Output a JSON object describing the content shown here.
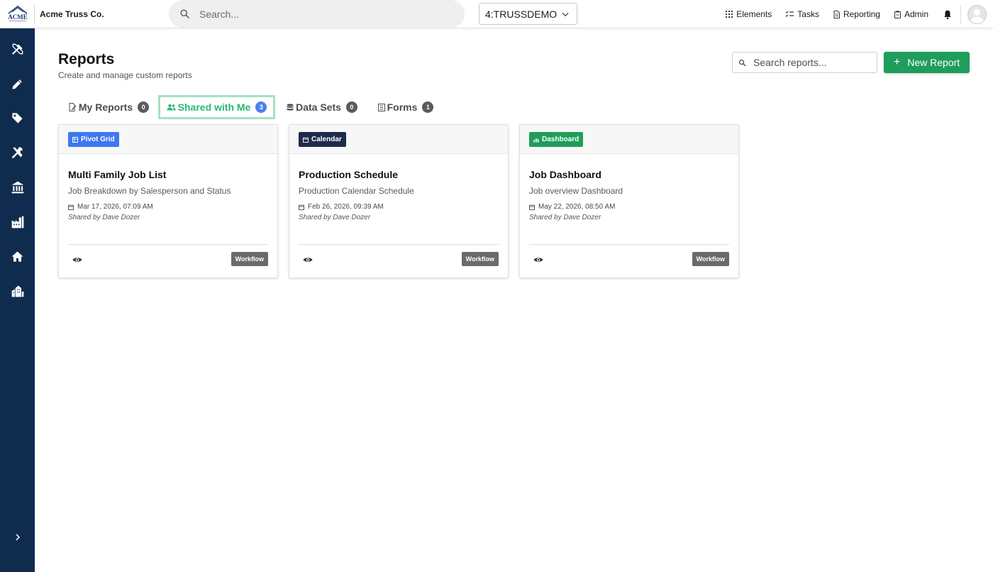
{
  "header": {
    "logo_text": "ACME",
    "company_name": "Acme Truss Co.",
    "search_placeholder": "Search...",
    "company_select": "4:TRUSSDEMO",
    "nav": {
      "elements": "Elements",
      "tasks": "Tasks",
      "reporting": "Reporting",
      "admin": "Admin"
    }
  },
  "sidebar": {
    "items": [
      {
        "icon": "design-tools-icon"
      },
      {
        "icon": "pencil-icon"
      },
      {
        "icon": "tag-icon"
      },
      {
        "icon": "tools-icon"
      },
      {
        "icon": "bank-icon"
      },
      {
        "icon": "factory-icon"
      },
      {
        "icon": "home-icon"
      },
      {
        "icon": "city-icon"
      }
    ],
    "expand_icon": "chevron-right-icon"
  },
  "page": {
    "title": "Reports",
    "subtitle": "Create and manage custom reports",
    "search_placeholder": "Search reports...",
    "new_button": "New Report"
  },
  "tabs": [
    {
      "label": "My Reports",
      "count": "0",
      "active": false
    },
    {
      "label": "Shared with Me",
      "count": "3",
      "active": true
    },
    {
      "label": "Data Sets",
      "count": "0",
      "active": false
    },
    {
      "label": "Forms",
      "count": "1",
      "active": false
    }
  ],
  "cards": [
    {
      "type": "Pivot Grid",
      "type_color": "#3d78f0",
      "title": "Multi Family Job List",
      "description": "Job Breakdown by Salesperson and Status",
      "date": "Mar 17, 2026, 07:09 AM",
      "shared_by": "Shared by Dave Dozer",
      "workflow": "Workflow"
    },
    {
      "type": "Calendar",
      "type_color": "#1d2b4a",
      "title": "Production Schedule",
      "description": "Production Calendar Schedule",
      "date": "Feb 26, 2026, 09:39 AM",
      "shared_by": "Shared by Dave Dozer",
      "workflow": "Workflow"
    },
    {
      "type": "Dashboard",
      "type_color": "#1f9d5a",
      "title": "Job Dashboard",
      "description": "Job overview Dashboard",
      "date": "May 22, 2026, 08:50 AM",
      "shared_by": "Shared by Dave Dozer",
      "workflow": "Workflow"
    }
  ],
  "colors": {
    "sidebar": "#0f2c4f",
    "primary_green": "#1f9d5a",
    "active_tab_text": "#26b870",
    "active_tab_border": "#a6e2c0",
    "active_count": "#4d7ff2"
  }
}
